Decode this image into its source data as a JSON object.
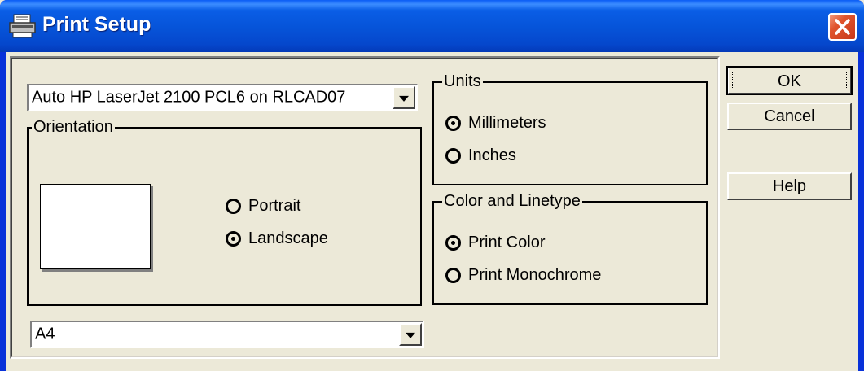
{
  "window": {
    "title": "Print Setup",
    "icon": "printer-icon",
    "close_icon": "close-icon"
  },
  "printer": {
    "selected": "Auto HP LaserJet 2100 PCL6 on RLCAD07"
  },
  "orientation": {
    "label": "Orientation",
    "options": [
      {
        "label": "Portrait",
        "selected": false
      },
      {
        "label": "Landscape",
        "selected": true
      }
    ]
  },
  "units": {
    "label": "Units",
    "options": [
      {
        "label": "Millimeters",
        "selected": true
      },
      {
        "label": "Inches",
        "selected": false
      }
    ]
  },
  "color_linetype": {
    "label": "Color and Linetype",
    "options": [
      {
        "label": "Print Color",
        "selected": true
      },
      {
        "label": "Print Monochrome",
        "selected": false
      }
    ]
  },
  "paper": {
    "selected": "A4"
  },
  "buttons": {
    "ok": "OK",
    "cancel": "Cancel",
    "help": "Help"
  },
  "colors": {
    "titlebar": "#0653d8",
    "face": "#ece9d8",
    "close": "#e0552e"
  }
}
